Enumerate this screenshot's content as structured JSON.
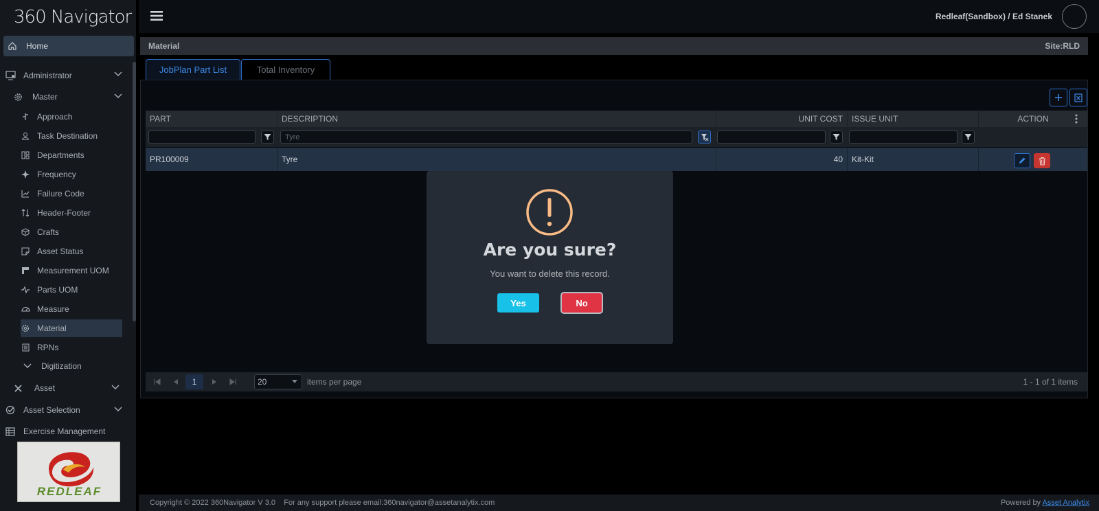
{
  "app": {
    "logo_text": "360 Navigator",
    "user_label": "Redleaf(Sandbox) / Ed Stanek"
  },
  "sidebar": {
    "home_label": "Home",
    "administrator_label": "Administrator",
    "master_label": "Master",
    "master_items": [
      {
        "label": "Approach",
        "icon": "approach-icon"
      },
      {
        "label": "Task Destination",
        "icon": "person-icon"
      },
      {
        "label": "Departments",
        "icon": "departments-icon"
      },
      {
        "label": "Frequency",
        "icon": "frequency-icon"
      },
      {
        "label": "Failure Code",
        "icon": "chart-icon"
      },
      {
        "label": "Header-Footer",
        "icon": "sort-icon"
      },
      {
        "label": "Crafts",
        "icon": "cube-icon"
      },
      {
        "label": "Asset Status",
        "icon": "note-icon"
      },
      {
        "label": "Measurement UOM",
        "icon": "ruler-icon"
      },
      {
        "label": "Parts UOM",
        "icon": "pulse-icon"
      },
      {
        "label": "Measure",
        "icon": "gauge-icon"
      },
      {
        "label": "Material",
        "icon": "gear-icon"
      },
      {
        "label": "RPNs",
        "icon": "list-icon"
      }
    ],
    "digitization_label": "Digitization",
    "asset_label": "Asset",
    "asset_selection_label": "Asset Selection",
    "exercise_label": "Exercise Management",
    "brand_text": "REDLEAF"
  },
  "breadcrumb": {
    "title": "Material",
    "site": "Site:RLD"
  },
  "tabs": [
    {
      "label": "JobPlan Part List"
    },
    {
      "label": "Total Inventory"
    }
  ],
  "grid": {
    "columns": {
      "part": "PART",
      "description": "DESCRIPTION",
      "unit_cost": "UNIT COST",
      "issue_unit": "ISSUE UNIT",
      "action": "ACTION"
    },
    "filters": {
      "part": "",
      "description": "Tyre",
      "unit_cost": "",
      "issue_unit": ""
    },
    "rows": [
      {
        "part": "PR100009",
        "description": "Tyre",
        "unit_cost": "40",
        "issue_unit": "Kit-Kit"
      }
    ]
  },
  "pager": {
    "page": "1",
    "page_size": "20",
    "per_page_label": "items per page",
    "summary": "1 - 1 of 1 items"
  },
  "dialog": {
    "title": "Are you sure?",
    "message": "You want to delete this record.",
    "yes_label": "Yes",
    "no_label": "No",
    "yes_color": "#17c1e8",
    "no_color": "#e03444"
  },
  "footer": {
    "copyright": "Copyright © 2022 360Navigator V 3.0",
    "support": "For any support please email:360navigator@assetanalytix.com",
    "powered_by": "Powered by",
    "powered_link": "Asset Analytix"
  }
}
